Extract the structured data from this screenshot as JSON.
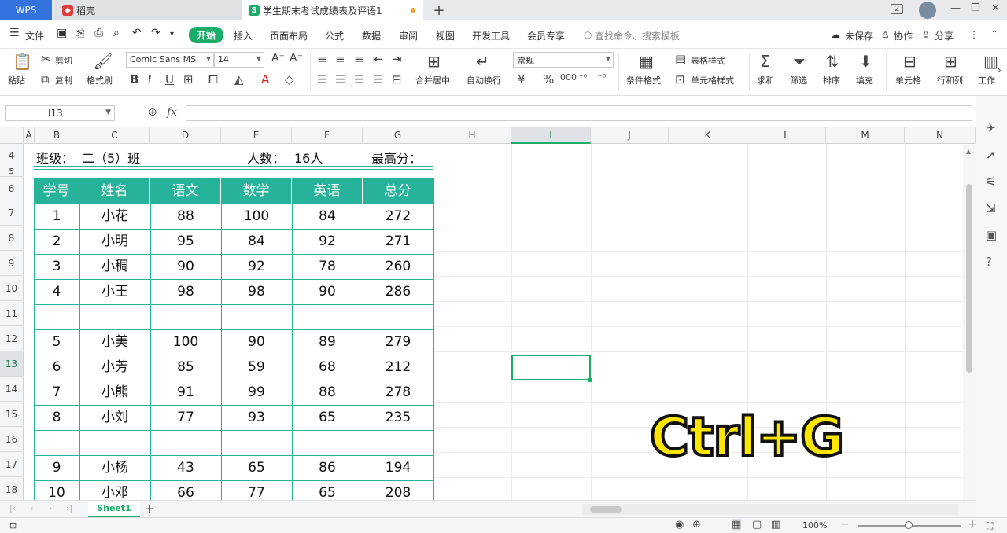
{
  "tabs": {
    "wps": "WPS",
    "daoke": "稻壳",
    "doc": "学生期末考试成绩表及评语1",
    "add": "+"
  },
  "window": {
    "badge": "2",
    "minimize": "—",
    "restore": "❐",
    "close": "✕"
  },
  "menu": {
    "file": "文件",
    "start": "开始",
    "items": [
      "插入",
      "页面布局",
      "公式",
      "数据",
      "审阅",
      "视图",
      "开发工具",
      "会员专享"
    ],
    "search": "查找命令、搜索模板",
    "unsaved": "未保存",
    "collab": "协作",
    "share": "分享"
  },
  "ribbon": {
    "paste": "粘贴",
    "cut": "剪切",
    "copy": "复制",
    "format_painter": "格式刷",
    "font": "Comic Sans MS",
    "size": "14",
    "merge": "合并居中",
    "wrap": "自动换行",
    "number_format": "常规",
    "cond_format": "条件格式",
    "table_style": "表格样式",
    "cell_style": "单元格样式",
    "sum": "求和",
    "filter": "筛选",
    "sort": "排序",
    "fill": "填充",
    "cell": "单元格",
    "rowcol": "行和列",
    "work": "工作"
  },
  "formula_bar": {
    "name": "I13",
    "fx": "fx"
  },
  "columns": [
    "A",
    "B",
    "C",
    "D",
    "E",
    "F",
    "G",
    "H",
    "I",
    "J",
    "K",
    "L",
    "M",
    "N"
  ],
  "rows": [
    "4",
    "5",
    "6",
    "7",
    "8",
    "9",
    "10",
    "11",
    "12",
    "13",
    "14",
    "15",
    "16",
    "17",
    "18"
  ],
  "info": {
    "class_label": "班级：",
    "class_value": "二（5）班",
    "count_label": "人数：",
    "count_value": "16人",
    "max_label": "最高分："
  },
  "table": {
    "headers": [
      "学号",
      "姓名",
      "语文",
      "数学",
      "英语",
      "总分"
    ],
    "rows": [
      [
        "1",
        "小花",
        "88",
        "100",
        "84",
        "272"
      ],
      [
        "2",
        "小明",
        "95",
        "84",
        "92",
        "271"
      ],
      [
        "3",
        "小稠",
        "90",
        "92",
        "78",
        "260"
      ],
      [
        "4",
        "小王",
        "98",
        "98",
        "90",
        "286"
      ],
      [
        "",
        "",
        "",
        "",
        "",
        ""
      ],
      [
        "5",
        "小美",
        "100",
        "90",
        "89",
        "279"
      ],
      [
        "6",
        "小芳",
        "85",
        "59",
        "68",
        "212"
      ],
      [
        "7",
        "小熊",
        "91",
        "99",
        "88",
        "278"
      ],
      [
        "8",
        "小刘",
        "77",
        "93",
        "65",
        "235"
      ],
      [
        "",
        "",
        "",
        "",
        "",
        ""
      ],
      [
        "9",
        "小杨",
        "43",
        "65",
        "86",
        "194"
      ],
      [
        "10",
        "小邓",
        "66",
        "77",
        "65",
        "208"
      ]
    ]
  },
  "overlay": "Ctrl+G",
  "sheet_tab": "Sheet1",
  "status": {
    "zoom": "100%"
  },
  "colors": {
    "accent": "#1aad6a",
    "table_header": "#26b39a",
    "overlay_text": "#ffe600"
  }
}
